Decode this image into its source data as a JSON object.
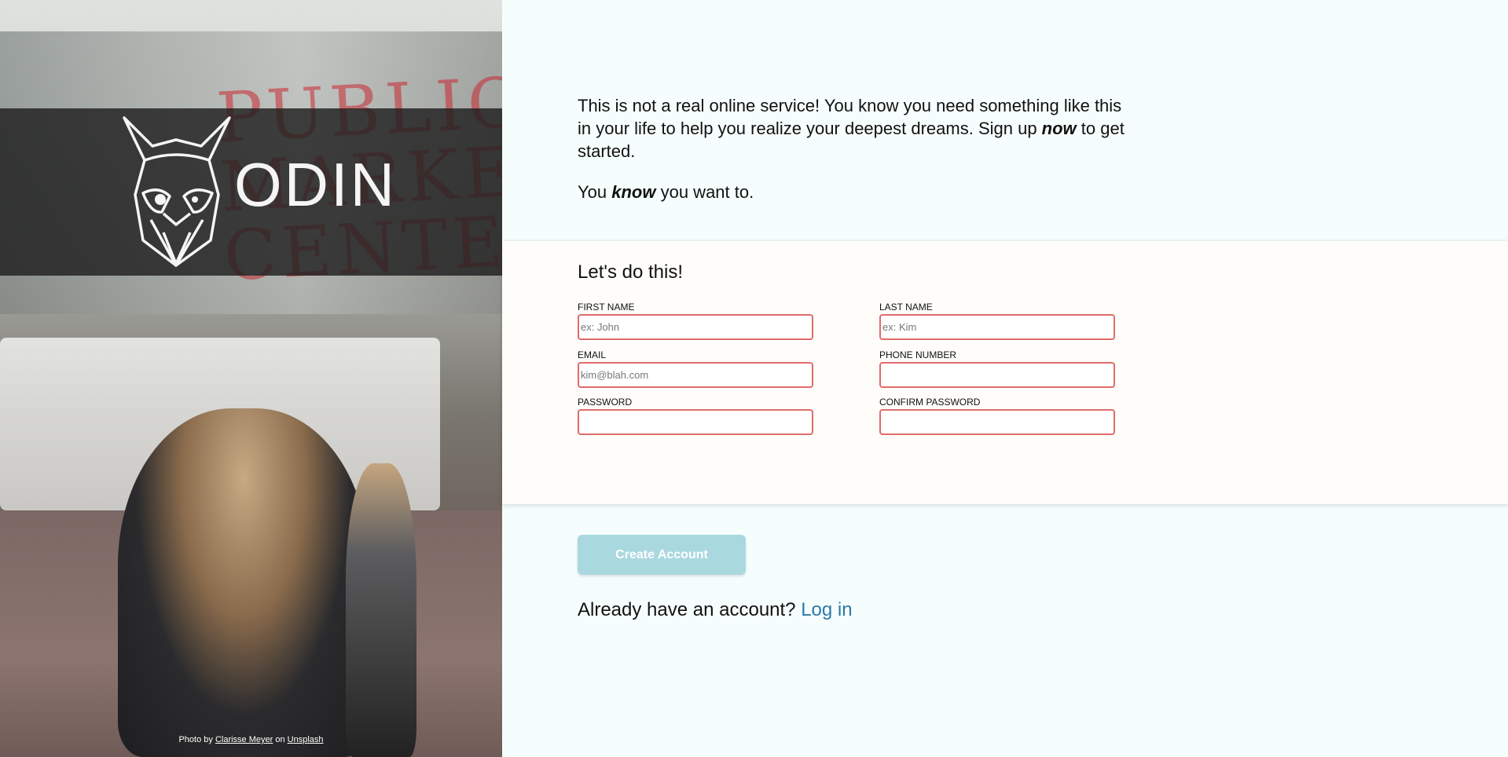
{
  "brand": {
    "name": "ODIN",
    "photo_credit_prefix": "Photo by",
    "photographer": "Clarisse Meyer",
    "credit_on": "on",
    "source": "Unsplash"
  },
  "intro": {
    "line1_before": "This is not a real online service! You know you need something like this in your life to help you realize your deepest dreams. Sign up ",
    "line1_em": "now",
    "line1_after": " to get started.",
    "line2_before": "You ",
    "line2_em": "know",
    "line2_after": " you want to."
  },
  "form": {
    "title": "Let's do this!",
    "first_name": {
      "label": "FIRST NAME",
      "placeholder": "ex: John",
      "value": ""
    },
    "last_name": {
      "label": "LAST NAME",
      "placeholder": "ex: Kim",
      "value": ""
    },
    "email": {
      "label": "EMAIL",
      "placeholder": "kim@blah.com",
      "value": ""
    },
    "phone": {
      "label": "PHONE NUMBER",
      "placeholder": "",
      "value": ""
    },
    "password": {
      "label": "PASSWORD",
      "placeholder": "",
      "value": ""
    },
    "confirm_password": {
      "label": "CONFIRM PASSWORD",
      "placeholder": "",
      "value": ""
    },
    "submit_label": "Create Account"
  },
  "login": {
    "prompt": "Already have an account?",
    "link_label": "Log in"
  },
  "colors": {
    "accent": "#2b7aa8",
    "button_bg": "#aad8df",
    "input_border": "#e06b6b",
    "page_bg": "#f6fefd"
  }
}
